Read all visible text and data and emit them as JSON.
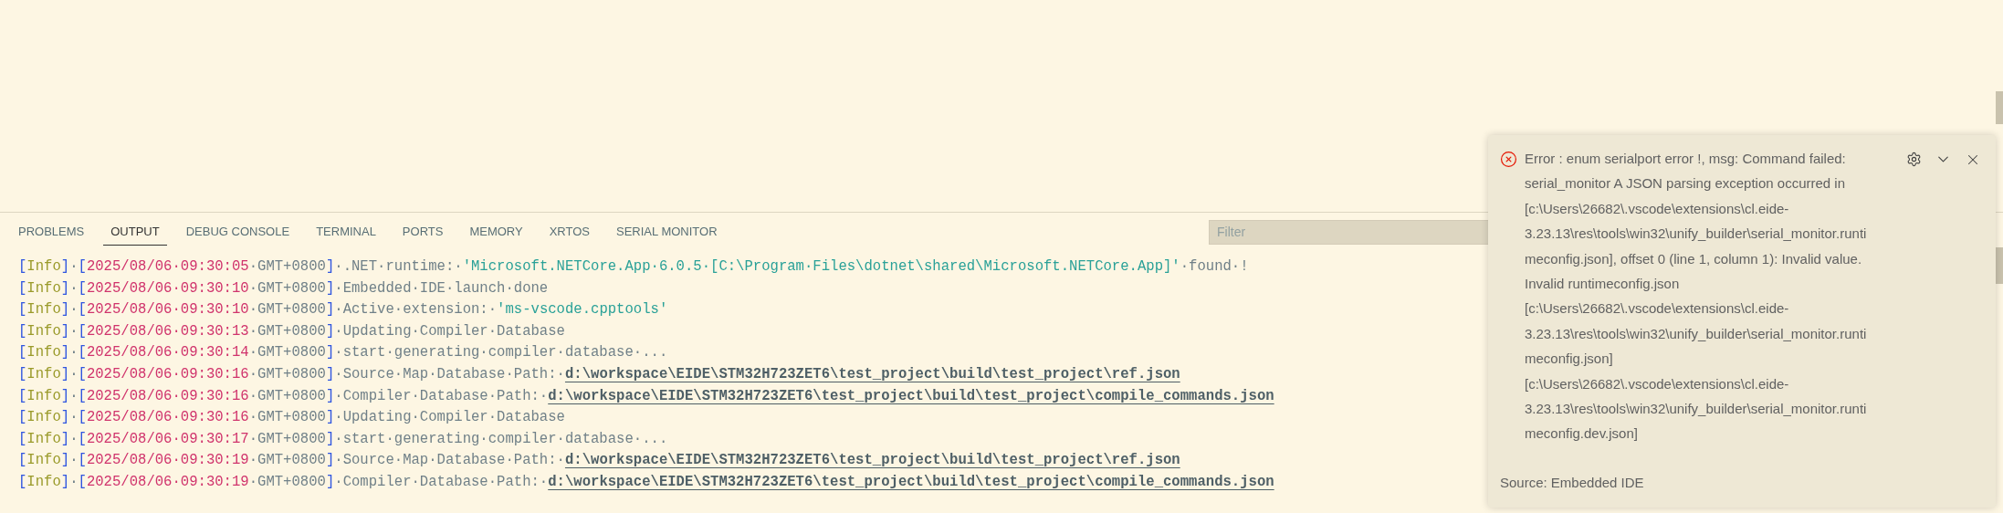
{
  "panel": {
    "tabs": [
      {
        "label": "PROBLEMS",
        "selected": false
      },
      {
        "label": "OUTPUT",
        "selected": true
      },
      {
        "label": "DEBUG CONSOLE",
        "selected": false
      },
      {
        "label": "TERMINAL",
        "selected": false
      },
      {
        "label": "PORTS",
        "selected": false
      },
      {
        "label": "MEMORY",
        "selected": false
      },
      {
        "label": "XRTOS",
        "selected": false
      },
      {
        "label": "SERIAL MONITOR",
        "selected": false
      }
    ],
    "filter": {
      "placeholder": "Filter"
    }
  },
  "output_lines": [
    [
      {
        "kind": "bracket",
        "text": "["
      },
      {
        "kind": "level",
        "text": "Info"
      },
      {
        "kind": "bracket",
        "text": "]"
      },
      {
        "kind": "text",
        "text": "·"
      },
      {
        "kind": "bracket",
        "text": "["
      },
      {
        "kind": "time",
        "text": "2025/08/06·09:30:05"
      },
      {
        "kind": "text",
        "text": "·GMT+0800"
      },
      {
        "kind": "bracket",
        "text": "]"
      },
      {
        "kind": "text",
        "text": "·.NET·runtime:·"
      },
      {
        "kind": "string",
        "text": "'Microsoft.NETCore.App·6.0.5·[C:\\Program·Files\\dotnet\\shared\\Microsoft.NETCore.App]'"
      },
      {
        "kind": "text",
        "text": "·found·!"
      }
    ],
    [
      {
        "kind": "bracket",
        "text": "["
      },
      {
        "kind": "level",
        "text": "Info"
      },
      {
        "kind": "bracket",
        "text": "]"
      },
      {
        "kind": "text",
        "text": "·"
      },
      {
        "kind": "bracket",
        "text": "["
      },
      {
        "kind": "time",
        "text": "2025/08/06·09:30:10"
      },
      {
        "kind": "text",
        "text": "·GMT+0800"
      },
      {
        "kind": "bracket",
        "text": "]"
      },
      {
        "kind": "text",
        "text": "·Embedded·IDE·launch·done"
      }
    ],
    [
      {
        "kind": "bracket",
        "text": "["
      },
      {
        "kind": "level",
        "text": "Info"
      },
      {
        "kind": "bracket",
        "text": "]"
      },
      {
        "kind": "text",
        "text": "·"
      },
      {
        "kind": "bracket",
        "text": "["
      },
      {
        "kind": "time",
        "text": "2025/08/06·09:30:10"
      },
      {
        "kind": "text",
        "text": "·GMT+0800"
      },
      {
        "kind": "bracket",
        "text": "]"
      },
      {
        "kind": "text",
        "text": "·Active·extension:·"
      },
      {
        "kind": "string",
        "text": "'ms-vscode.cpptools'"
      }
    ],
    [
      {
        "kind": "bracket",
        "text": "["
      },
      {
        "kind": "level",
        "text": "Info"
      },
      {
        "kind": "bracket",
        "text": "]"
      },
      {
        "kind": "text",
        "text": "·"
      },
      {
        "kind": "bracket",
        "text": "["
      },
      {
        "kind": "time",
        "text": "2025/08/06·09:30:13"
      },
      {
        "kind": "text",
        "text": "·GMT+0800"
      },
      {
        "kind": "bracket",
        "text": "]"
      },
      {
        "kind": "text",
        "text": "·Updating·Compiler·Database"
      }
    ],
    [
      {
        "kind": "bracket",
        "text": "["
      },
      {
        "kind": "level",
        "text": "Info"
      },
      {
        "kind": "bracket",
        "text": "]"
      },
      {
        "kind": "text",
        "text": "·"
      },
      {
        "kind": "bracket",
        "text": "["
      },
      {
        "kind": "time",
        "text": "2025/08/06·09:30:14"
      },
      {
        "kind": "text",
        "text": "·GMT+0800"
      },
      {
        "kind": "bracket",
        "text": "]"
      },
      {
        "kind": "text",
        "text": "·start·generating·compiler·database·..."
      }
    ],
    [
      {
        "kind": "bracket",
        "text": "["
      },
      {
        "kind": "level",
        "text": "Info"
      },
      {
        "kind": "bracket",
        "text": "]"
      },
      {
        "kind": "text",
        "text": "·"
      },
      {
        "kind": "bracket",
        "text": "["
      },
      {
        "kind": "time",
        "text": "2025/08/06·09:30:16"
      },
      {
        "kind": "text",
        "text": "·GMT+0800"
      },
      {
        "kind": "bracket",
        "text": "]"
      },
      {
        "kind": "text",
        "text": "·Source·Map·Database·Path:·"
      },
      {
        "kind": "link",
        "text": "d:\\workspace\\EIDE\\STM32H723ZET6\\test_project\\build\\test_project\\ref.json"
      }
    ],
    [
      {
        "kind": "bracket",
        "text": "["
      },
      {
        "kind": "level",
        "text": "Info"
      },
      {
        "kind": "bracket",
        "text": "]"
      },
      {
        "kind": "text",
        "text": "·"
      },
      {
        "kind": "bracket",
        "text": "["
      },
      {
        "kind": "time",
        "text": "2025/08/06·09:30:16"
      },
      {
        "kind": "text",
        "text": "·GMT+0800"
      },
      {
        "kind": "bracket",
        "text": "]"
      },
      {
        "kind": "text",
        "text": "·Compiler·Database·Path:·"
      },
      {
        "kind": "link",
        "text": "d:\\workspace\\EIDE\\STM32H723ZET6\\test_project\\build\\test_project\\compile_commands.json"
      }
    ],
    [
      {
        "kind": "bracket",
        "text": "["
      },
      {
        "kind": "level",
        "text": "Info"
      },
      {
        "kind": "bracket",
        "text": "]"
      },
      {
        "kind": "text",
        "text": "·"
      },
      {
        "kind": "bracket",
        "text": "["
      },
      {
        "kind": "time",
        "text": "2025/08/06·09:30:16"
      },
      {
        "kind": "text",
        "text": "·GMT+0800"
      },
      {
        "kind": "bracket",
        "text": "]"
      },
      {
        "kind": "text",
        "text": "·Updating·Compiler·Database"
      }
    ],
    [
      {
        "kind": "bracket",
        "text": "["
      },
      {
        "kind": "level",
        "text": "Info"
      },
      {
        "kind": "bracket",
        "text": "]"
      },
      {
        "kind": "text",
        "text": "·"
      },
      {
        "kind": "bracket",
        "text": "["
      },
      {
        "kind": "time",
        "text": "2025/08/06·09:30:17"
      },
      {
        "kind": "text",
        "text": "·GMT+0800"
      },
      {
        "kind": "bracket",
        "text": "]"
      },
      {
        "kind": "text",
        "text": "·start·generating·compiler·database·..."
      }
    ],
    [
      {
        "kind": "bracket",
        "text": "["
      },
      {
        "kind": "level",
        "text": "Info"
      },
      {
        "kind": "bracket",
        "text": "]"
      },
      {
        "kind": "text",
        "text": "·"
      },
      {
        "kind": "bracket",
        "text": "["
      },
      {
        "kind": "time",
        "text": "2025/08/06·09:30:19"
      },
      {
        "kind": "text",
        "text": "·GMT+0800"
      },
      {
        "kind": "bracket",
        "text": "]"
      },
      {
        "kind": "text",
        "text": "·Source·Map·Database·Path:·"
      },
      {
        "kind": "link",
        "text": "d:\\workspace\\EIDE\\STM32H723ZET6\\test_project\\build\\test_project\\ref.json"
      }
    ],
    [
      {
        "kind": "bracket",
        "text": "["
      },
      {
        "kind": "level",
        "text": "Info"
      },
      {
        "kind": "bracket",
        "text": "]"
      },
      {
        "kind": "text",
        "text": "·"
      },
      {
        "kind": "bracket",
        "text": "["
      },
      {
        "kind": "time",
        "text": "2025/08/06·09:30:19"
      },
      {
        "kind": "text",
        "text": "·GMT+0800"
      },
      {
        "kind": "bracket",
        "text": "]"
      },
      {
        "kind": "text",
        "text": "·Compiler·Database·Path:·"
      },
      {
        "kind": "link",
        "text": "d:\\workspace\\EIDE\\STM32H723ZET6\\test_project\\build\\test_project\\compile_commands.json"
      }
    ]
  ],
  "notification": {
    "message_lines": [
      "Error : enum serialport error !, msg: Command failed:",
      "serial_monitor A JSON parsing exception occurred in",
      "[c:\\Users\\26682\\.vscode\\extensions\\cl.eide-",
      "3.23.13\\res\\tools\\win32\\unify_builder\\serial_monitor.runti",
      "meconfig.json], offset 0 (line 1, column 1): Invalid value.",
      "Invalid runtimeconfig.json",
      "[c:\\Users\\26682\\.vscode\\extensions\\cl.eide-",
      "3.23.13\\res\\tools\\win32\\unify_builder\\serial_monitor.runti",
      "meconfig.json]",
      "[c:\\Users\\26682\\.vscode\\extensions\\cl.eide-",
      "3.23.13\\res\\tools\\win32\\unify_builder\\serial_monitor.runti",
      "meconfig.dev.json]"
    ],
    "source": "Source: Embedded IDE"
  }
}
